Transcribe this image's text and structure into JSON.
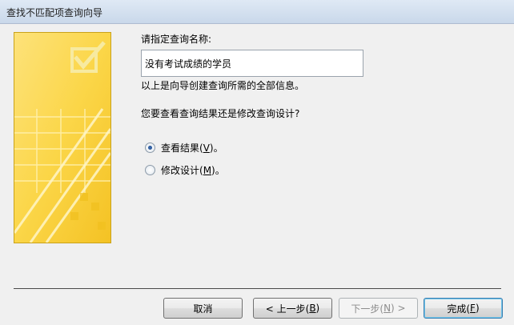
{
  "window": {
    "title": "查找不匹配项查询向导"
  },
  "form": {
    "name_label": "请指定查询名称:",
    "name_value": "没有考试成绩的学员",
    "info_text": "以上是向导创建查询所需的全部信息。",
    "question": "您要查看查询结果还是修改查询设计?",
    "options": [
      {
        "label": "查看结果(",
        "hotkey": "V",
        "suffix": ")。",
        "checked": true
      },
      {
        "label": "修改设计(",
        "hotkey": "M",
        "suffix": ")。",
        "checked": false
      }
    ]
  },
  "buttons": {
    "cancel": {
      "label": "取消"
    },
    "back": {
      "prefix": "< 上一步(",
      "hotkey": "B",
      "suffix": ")"
    },
    "next": {
      "prefix": "下一步(",
      "hotkey": "N",
      "suffix": ") >",
      "disabled": true
    },
    "finish": {
      "prefix": "完成(",
      "hotkey": "F",
      "suffix": ")"
    }
  },
  "colors": {
    "illustration_fill": "#fbd648",
    "illustration_border": "#c9a21b"
  }
}
